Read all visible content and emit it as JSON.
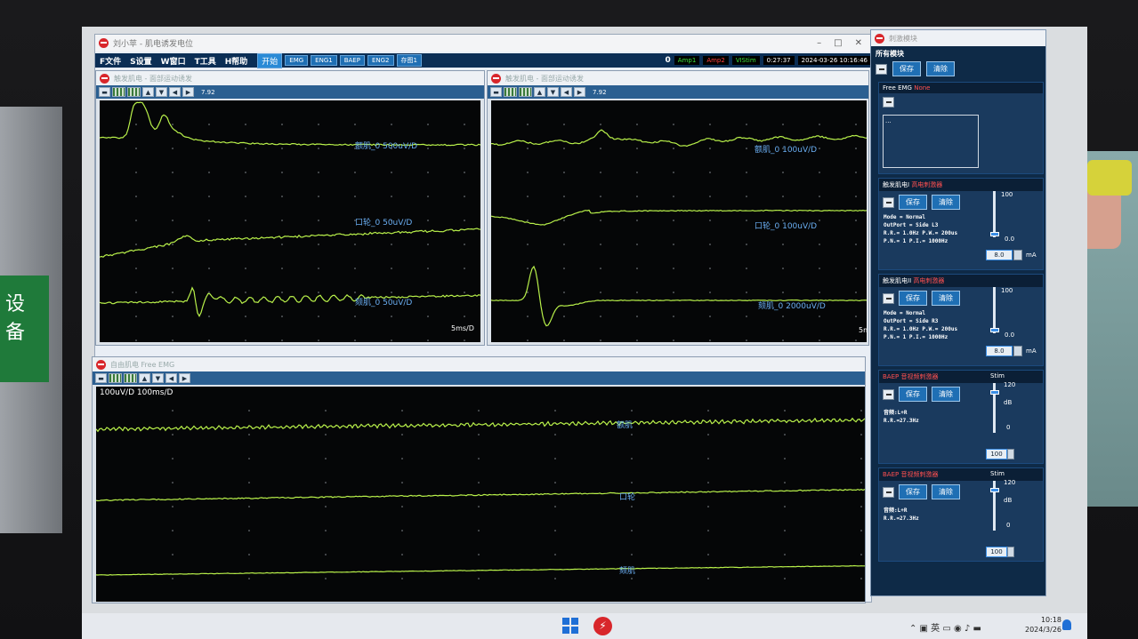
{
  "main_window": {
    "title": "刘小苹 - 肌电诱发电位"
  },
  "menu": {
    "file": "F文件",
    "settings": "S设置",
    "window": "W窗口",
    "tools": "T工具",
    "help": "H帮助",
    "buttons": [
      "开始",
      "EMG",
      "ENG1",
      "BAEP",
      "ENG2",
      "存图1"
    ]
  },
  "status": {
    "zero": "0",
    "amp1": "Amp1",
    "amp2": "Amp2",
    "vistim": "VIStim",
    "time": "0:27:37",
    "date": "2024-03-26 10:16:46"
  },
  "win1": {
    "title": "触发肌电 - 面部运动诱发",
    "tool_value": "7.92",
    "traces": [
      {
        "label": "额肌_0  500uV/D"
      },
      {
        "label": "口轮_0  50uV/D"
      },
      {
        "label": "颏肌_0  50uV/D"
      }
    ],
    "timebase": "5ms/D"
  },
  "win2": {
    "title": "触发肌电 - 面部运动诱发",
    "tool_value": "7.92",
    "traces": [
      {
        "label": "额肌_0  100uV/D"
      },
      {
        "label": "口轮_0  100uV/D"
      },
      {
        "label": "颏肌_0  2000uV/D"
      }
    ],
    "timebase": "5m"
  },
  "win3": {
    "title": "自由肌电 Free EMG",
    "scale": "100uV/D  100ms/D",
    "traces": [
      {
        "label": "额肌"
      },
      {
        "label": "口轮"
      },
      {
        "label": "颏肌"
      }
    ]
  },
  "sidebar": {
    "title": "刺激模块",
    "header": "所有模块",
    "save": "保存",
    "clear": "清除",
    "free_emg": {
      "header": "Free EMG",
      "none": "None",
      "box_text": "..."
    },
    "stim1": {
      "header": "触发肌电I",
      "type": "高电刺激器",
      "save": "保存",
      "clear": "清除",
      "info": [
        "Mode = Normal",
        "OutPort = Side L3",
        "R.R.= 1.0Hz  P.W.= 200us",
        "P.N.= 1   P.I.= 1000Hz"
      ],
      "max": "100",
      "min": "0.0",
      "value": "8.0",
      "unit": "mA",
      "level": 0.08
    },
    "stim2": {
      "header": "触发肌电II",
      "type": "高电刺激器",
      "save": "保存",
      "clear": "清除",
      "info": [
        "Mode = Normal",
        "OutPort = Side R3",
        "R.R.= 1.0Hz  P.W.= 200us",
        "P.N.= 1   P.I.= 1000Hz"
      ],
      "max": "100",
      "min": "0.0",
      "value": "8.0",
      "unit": "mA",
      "level": 0.08
    },
    "baep1": {
      "header": "BAEP",
      "type": "音视频刺激器",
      "save": "保存",
      "clear": "清除",
      "info": [
        "音频:L+R",
        "R.R.=27.3Hz"
      ],
      "stim": "Stim",
      "max": "120",
      "db": "dB",
      "zero": "0",
      "value": "100",
      "level": 0.83
    },
    "baep2": {
      "header": "BAEP",
      "type": "音视频刺激器",
      "save": "保存",
      "clear": "清除",
      "info": [
        "音频:L+R",
        "R.R.=27.3Hz"
      ],
      "stim": "Stim",
      "max": "120",
      "db": "dB",
      "zero": "0",
      "value": "100",
      "level": 0.83
    }
  },
  "taskbar": {
    "clock_time": "10:18",
    "clock_date": "2024/3/26"
  }
}
